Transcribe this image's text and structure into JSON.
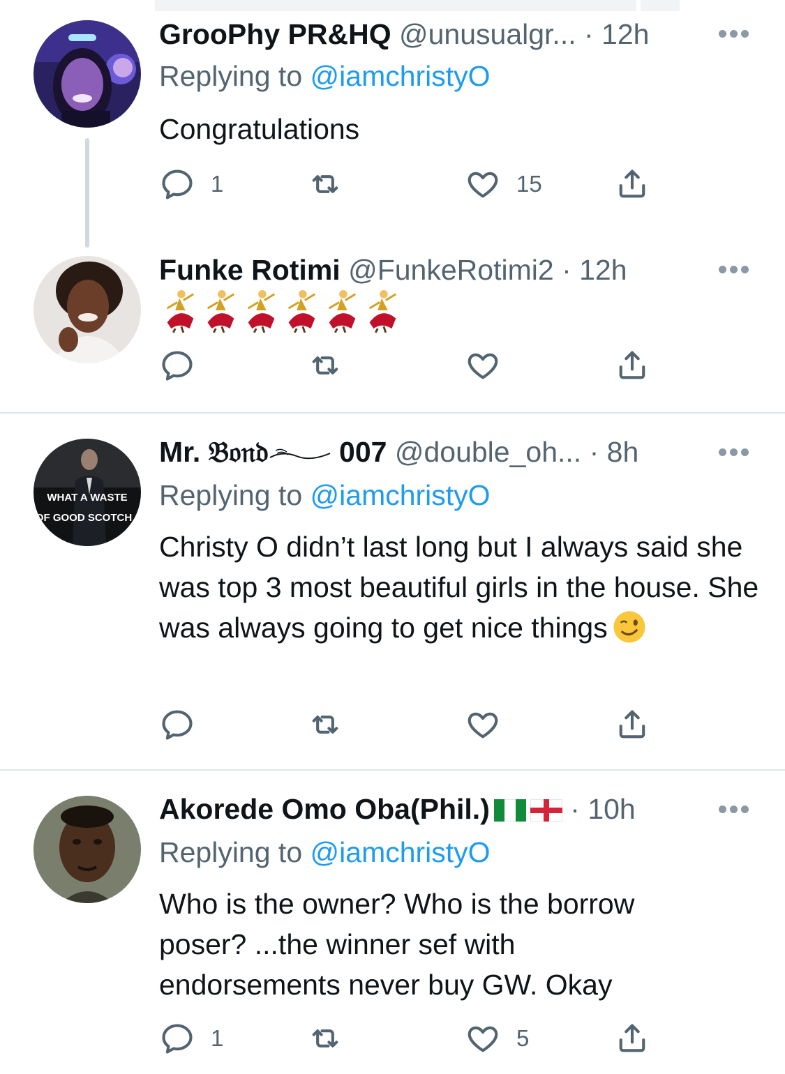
{
  "tweets": [
    {
      "display_name": "GrooPhy PR&HQ",
      "handle": "@unusualgr...",
      "dot": "·",
      "time": "12h",
      "replying_prefix": "Replying to",
      "replying_to": "@iamchristyO",
      "text": "Congratulations",
      "reply_count": "1",
      "retweet_count": "",
      "like_count": "15"
    },
    {
      "display_name": "Funke Rotimi",
      "handle": "@FunkeRotimi2",
      "dot": "·",
      "time": "12h",
      "emoji": "💃💃💃💃💃💃",
      "reply_count": "",
      "retweet_count": "",
      "like_count": ""
    },
    {
      "display_name_prefix": "Mr. ",
      "display_name_blackletter": "𝔅𝔬𝔫𝔡",
      "display_name_suffix": " 007",
      "handle": "@double_oh...",
      "dot": "·",
      "time": "8h",
      "avatar_caption_line1": "WHAT A WASTE",
      "avatar_caption_line2": "OF GOOD SCOTCH",
      "replying_prefix": "Replying to",
      "replying_to": "@iamchristyO",
      "text": "Christy O didn’t last long but I always said she was top 3 most beautiful girls in the house. She was always going to get nice things",
      "reply_count": "",
      "retweet_count": "",
      "like_count": ""
    },
    {
      "display_name": "Akorede Omo Oba(Phil.)",
      "handle": "",
      "dot": "·",
      "time": "10h",
      "flags": [
        "nigeria-flag",
        "england-flag"
      ],
      "replying_prefix": "Replying to",
      "replying_to": "@iamchristyO",
      "text_lines": [
        "Who is the owner? Who is the borrow",
        "poser? ...the winner sef with",
        "endorsements never buy GW. Okay"
      ],
      "reply_count": "1",
      "retweet_count": "",
      "like_count": "5"
    }
  ],
  "colors": {
    "name": "#0f1419",
    "secondary": "#536471",
    "link": "#1d9bf0",
    "divider": "#e1e6ea",
    "thread_line": "#cfd9de"
  },
  "icons": [
    "reply-icon",
    "retweet-icon",
    "like-icon",
    "share-icon",
    "more-icon"
  ]
}
